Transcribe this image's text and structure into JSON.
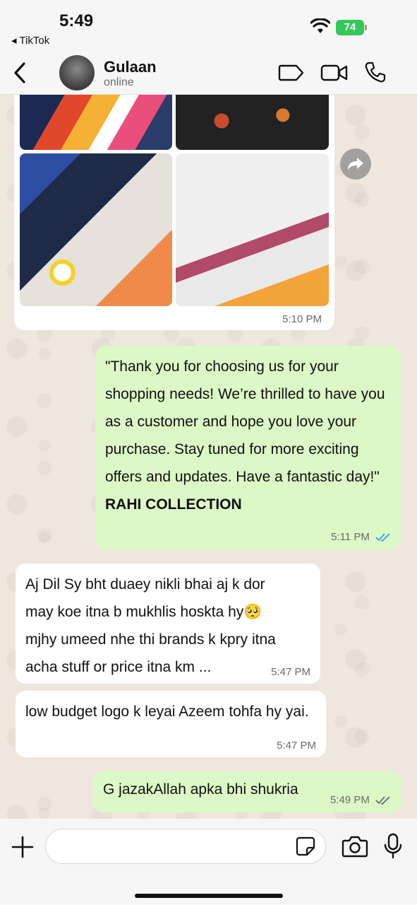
{
  "status_bar": {
    "time": "5:49",
    "back_app": "◂ TikTok",
    "battery": "74"
  },
  "header": {
    "contact_name": "Gulaan",
    "contact_status": "online"
  },
  "messages": {
    "image_time": "5:10 PM",
    "m1": {
      "text": "\"Thank you for choosing us for your shopping needs! We’re thrilled to have you as a customer and hope you love your purchase. Stay tuned for more exciting offers and updates. Have a fantastic day!\"",
      "signature": "RAHI COLLECTION",
      "time": "5:11 PM",
      "status": "read"
    },
    "m2": {
      "text": "Aj Dil Sy bht duaey nikli bhai aj k dor may koe itna b mukhlis hoskta hy🥺 mjhy umeed nhe thi brands k kpry itna acha stuff or price itna km ...",
      "time": "5:47 PM"
    },
    "m3": {
      "text": "low budget logo k leyai Azeem tohfa hy yai.",
      "time": "5:47 PM"
    },
    "m4": {
      "text": "G jazakAllah apka bhi shukria",
      "time": "5:49 PM",
      "status": "delivered"
    }
  },
  "input": {
    "placeholder": ""
  },
  "colors": {
    "outgoing": "#dcf8c6",
    "incoming": "#ffffff",
    "read_ticks": "#34a0f4",
    "accent": "#34c759"
  }
}
